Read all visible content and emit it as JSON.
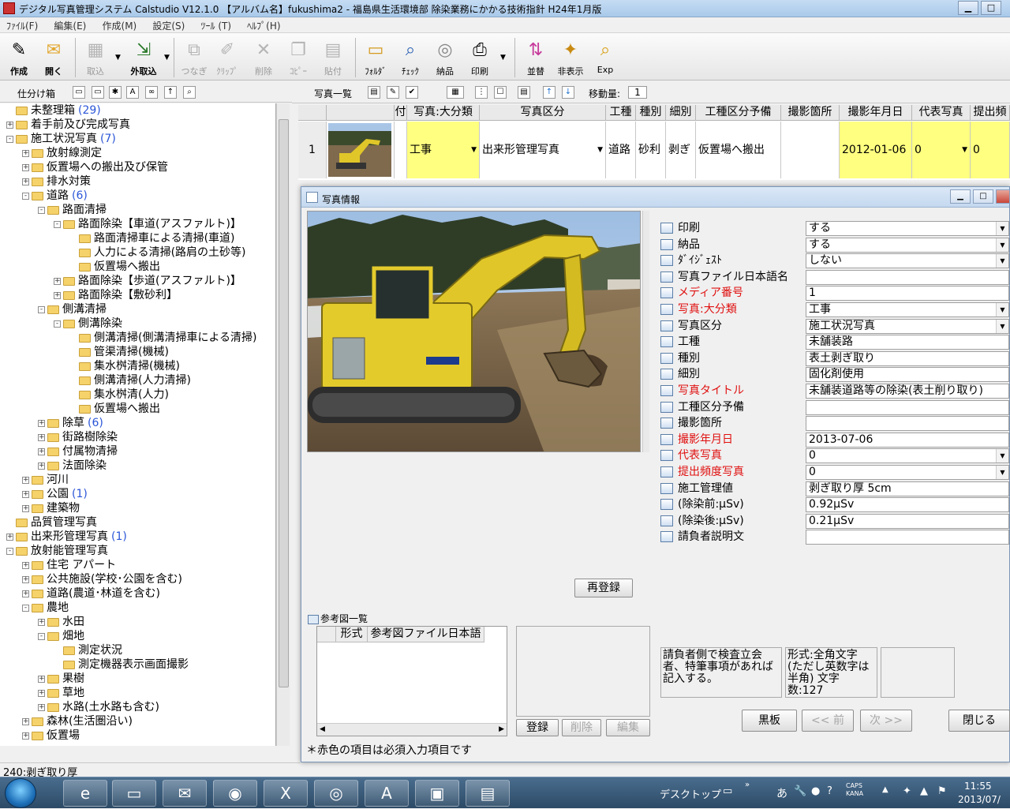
{
  "window": {
    "title": "デジタル写真管理システム Calstudio V12.1.0 【アルバム名】fukushima2 - 福島県生活環境部 除染業務にかかる技術指針 H24年1月版",
    "min": "▁",
    "max": "□"
  },
  "menu": [
    "ﾌｧｲﾙ(F)",
    "編集(E)",
    "作成(M)",
    "設定(S)",
    "ﾂｰﾙ (T)",
    "ﾍﾙﾌﾟ(H)"
  ],
  "toolbar": {
    "create": "作成",
    "open": "開く",
    "import": "取込",
    "ext_import": "外取込",
    "connect": "つなぎ",
    "clip": "ｸﾘｯﾌﾟ",
    "delete": "削除",
    "copy": "ｺﾋﾟｰ",
    "paste": "貼付",
    "folder": "ﾌｫﾙﾀﾞ",
    "check": "ﾁｪｯｸ",
    "deliver": "納品",
    "print": "印刷",
    "sort": "並替",
    "hide": "非表示",
    "exp": "Exp"
  },
  "left_panel": {
    "label": "仕分け箱",
    "status": "240:剥ぎ取り厚"
  },
  "tree": [
    {
      "label": "未整理箱",
      "count": "(29)",
      "level": 0,
      "exp": ""
    },
    {
      "label": "着手前及び完成写真",
      "count": "",
      "level": 0,
      "exp": "+"
    },
    {
      "label": "施工状況写真",
      "count": "(7)",
      "level": 0,
      "exp": "-"
    },
    {
      "label": "放射線測定",
      "count": "",
      "level": 1,
      "exp": "+"
    },
    {
      "label": "仮置場への搬出及び保管",
      "count": "",
      "level": 1,
      "exp": "+"
    },
    {
      "label": "排水対策",
      "count": "",
      "level": 1,
      "exp": "+"
    },
    {
      "label": "道路",
      "count": "(6)",
      "level": 1,
      "exp": "-"
    },
    {
      "label": "路面清掃",
      "count": "",
      "level": 2,
      "exp": "-"
    },
    {
      "label": "路面除染【車道(アスファルト)】",
      "count": "",
      "level": 3,
      "exp": "-"
    },
    {
      "label": "路面清掃車による清掃(車道)",
      "count": "",
      "level": 4,
      "exp": ""
    },
    {
      "label": "人力による清掃(路肩の土砂等)",
      "count": "",
      "level": 4,
      "exp": ""
    },
    {
      "label": "仮置場へ搬出",
      "count": "",
      "level": 4,
      "exp": ""
    },
    {
      "label": "路面除染【歩道(アスファルト)】",
      "count": "",
      "level": 3,
      "exp": "+"
    },
    {
      "label": "路面除染【敷砂利】",
      "count": "",
      "level": 3,
      "exp": "+"
    },
    {
      "label": "側溝清掃",
      "count": "",
      "level": 2,
      "exp": "-"
    },
    {
      "label": "側溝除染",
      "count": "",
      "level": 3,
      "exp": "-"
    },
    {
      "label": "側溝清掃(側溝清掃車による清掃)",
      "count": "",
      "level": 4,
      "exp": ""
    },
    {
      "label": "管渠清掃(機械)",
      "count": "",
      "level": 4,
      "exp": ""
    },
    {
      "label": "集水桝清掃(機械)",
      "count": "",
      "level": 4,
      "exp": ""
    },
    {
      "label": "側溝清掃(人力清掃)",
      "count": "",
      "level": 4,
      "exp": ""
    },
    {
      "label": "集水桝清(人力)",
      "count": "",
      "level": 4,
      "exp": ""
    },
    {
      "label": "仮置場へ搬出",
      "count": "",
      "level": 4,
      "exp": ""
    },
    {
      "label": "除草",
      "count": "(6)",
      "level": 2,
      "exp": "+"
    },
    {
      "label": "街路樹除染",
      "count": "",
      "level": 2,
      "exp": "+"
    },
    {
      "label": "付属物清掃",
      "count": "",
      "level": 2,
      "exp": "+"
    },
    {
      "label": "法面除染",
      "count": "",
      "level": 2,
      "exp": "+"
    },
    {
      "label": "河川",
      "count": "",
      "level": 1,
      "exp": "+"
    },
    {
      "label": "公園",
      "count": "(1)",
      "level": 1,
      "exp": "+"
    },
    {
      "label": "建築物",
      "count": "",
      "level": 1,
      "exp": "+"
    },
    {
      "label": "品質管理写真",
      "count": "",
      "level": 0,
      "exp": ""
    },
    {
      "label": "出来形管理写真",
      "count": "(1)",
      "level": 0,
      "exp": "+"
    },
    {
      "label": "放射能管理写真",
      "count": "",
      "level": 0,
      "exp": "-"
    },
    {
      "label": "住宅 アパート",
      "count": "",
      "level": 1,
      "exp": "+"
    },
    {
      "label": "公共施設(学校･公園を含む)",
      "count": "",
      "level": 1,
      "exp": "+"
    },
    {
      "label": "道路(農道･林道を含む)",
      "count": "",
      "level": 1,
      "exp": "+"
    },
    {
      "label": "農地",
      "count": "",
      "level": 1,
      "exp": "-"
    },
    {
      "label": "水田",
      "count": "",
      "level": 2,
      "exp": "+"
    },
    {
      "label": "畑地",
      "count": "",
      "level": 2,
      "exp": "-"
    },
    {
      "label": "測定状況",
      "count": "",
      "level": 3,
      "exp": ""
    },
    {
      "label": "測定機器表示画面撮影",
      "count": "",
      "level": 3,
      "exp": ""
    },
    {
      "label": "果樹",
      "count": "",
      "level": 2,
      "exp": "+"
    },
    {
      "label": "草地",
      "count": "",
      "level": 2,
      "exp": "+"
    },
    {
      "label": "水路(土水路も含む)",
      "count": "",
      "level": 2,
      "exp": "+"
    },
    {
      "label": "森林(生活圏沿い)",
      "count": "",
      "level": 1,
      "exp": "+"
    },
    {
      "label": "仮置場",
      "count": "",
      "level": 1,
      "exp": "+"
    }
  ],
  "right_toolbar": {
    "list_label": "写真一覧",
    "move_label": "移動量:",
    "move_value": "1"
  },
  "grid": {
    "headers": [
      "付",
      "写真:大分類",
      "写真区分",
      "工種",
      "種別",
      "細別",
      "工種区分予備",
      "撮影箇所",
      "撮影年月日",
      "代表写真",
      "提出頻"
    ],
    "row": {
      "num": "1",
      "major": "工事",
      "kubun": "出来形管理写真",
      "kousyu": "道路",
      "shubetsu": "砂利",
      "saibetsu": "剥ぎ",
      "yobi": "仮置場へ搬出",
      "place": "",
      "date": "2012-01-06",
      "rep": "0",
      "freq": "0"
    }
  },
  "dialog": {
    "title": "写真情報",
    "rows": [
      {
        "label": "印刷",
        "value": "する",
        "req": false,
        "dropdown": true
      },
      {
        "label": "納品",
        "value": "する",
        "req": false,
        "dropdown": true
      },
      {
        "label": "ﾀﾞｲｼﾞｪｽﾄ",
        "value": "しない",
        "req": false,
        "dropdown": true
      },
      {
        "label": "写真ファイル日本語名",
        "value": "",
        "req": false,
        "dropdown": false
      },
      {
        "label": "メディア番号",
        "value": "1",
        "req": true,
        "dropdown": false
      },
      {
        "label": "写真:大分類",
        "value": "工事",
        "req": true,
        "dropdown": true
      },
      {
        "label": "写真区分",
        "value": "施工状況写真",
        "req": false,
        "dropdown": true
      },
      {
        "label": "工種",
        "value": "未舗装路",
        "req": false,
        "dropdown": false
      },
      {
        "label": "種別",
        "value": "表土剥ぎ取り",
        "req": false,
        "dropdown": false
      },
      {
        "label": "細別",
        "value": "固化剤使用",
        "req": false,
        "dropdown": false
      },
      {
        "label": "写真タイトル",
        "value": "未舗装道路等の除染(表土削り取り)",
        "req": true,
        "dropdown": false
      },
      {
        "label": "工種区分予備",
        "value": "",
        "req": false,
        "dropdown": false
      },
      {
        "label": "撮影箇所",
        "value": "",
        "req": false,
        "dropdown": false
      },
      {
        "label": "撮影年月日",
        "value": "2013-07-06",
        "req": true,
        "dropdown": false
      },
      {
        "label": "代表写真",
        "value": "0",
        "req": true,
        "dropdown": true
      },
      {
        "label": "提出頻度写真",
        "value": "0",
        "req": true,
        "dropdown": true
      },
      {
        "label": "施工管理値",
        "value": "剥ぎ取り厚 5cm",
        "req": false,
        "dropdown": false
      },
      {
        "label": "(除染前:μSv)",
        "value": "0.92μSv",
        "req": false,
        "dropdown": false
      },
      {
        "label": "(除染後:μSv)",
        "value": "0.21μSv",
        "req": false,
        "dropdown": false
      },
      {
        "label": "請負者説明文",
        "value": "",
        "req": false,
        "dropdown": false
      }
    ],
    "reregister": "再登録",
    "ref_label": "参考図一覧",
    "ref_headers": [
      "形式",
      "参考図ファイル日本語"
    ],
    "register": "登録",
    "delete": "削除",
    "edit": "編集",
    "help1": "請負者側で検査立会者、特筆事項があれば記入する。",
    "help2": "形式:全角文字 (ただし英数字は半角) 文字数:127",
    "blackboard": "黒板",
    "prev": "<< 前",
    "next": "次 >>",
    "close": "閉じる",
    "footer": "＊赤色の項目は必須入力項目です"
  },
  "taskbar": {
    "desktop": "デスクトップ",
    "time": "11:55",
    "date": "2013/07/"
  }
}
